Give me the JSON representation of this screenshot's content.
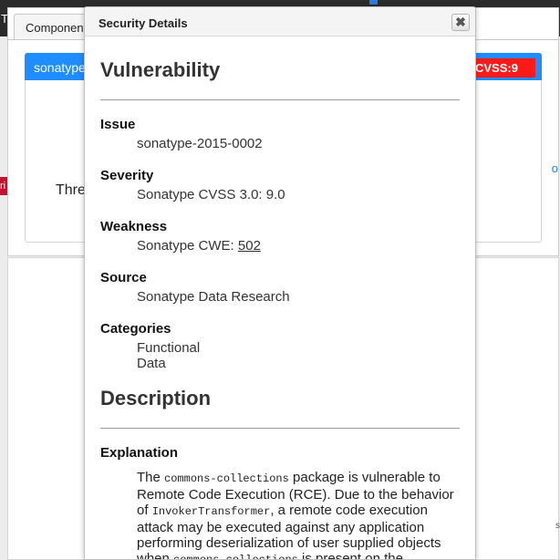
{
  "background": {
    "topbar_left_fragment": "T",
    "topbar_right_fragment": "r",
    "tab_label": "Component",
    "package_fragment": "sonatype",
    "cvss_badge": "CVSS:9",
    "threat_fragment": "Thre",
    "right_fragment": "o",
    "right_lower_fragment": "s",
    "red_tab_fragment": "ri"
  },
  "modal": {
    "title": "Security Details",
    "close_glyph": "✖",
    "vulnerability_heading": "Vulnerability",
    "issue": {
      "label": "Issue",
      "value": "sonatype-2015-0002"
    },
    "severity": {
      "label": "Severity",
      "value": "Sonatype CVSS 3.0: 9.0"
    },
    "weakness": {
      "label": "Weakness",
      "prefix": "Sonatype CWE: ",
      "link": "502"
    },
    "source": {
      "label": "Source",
      "value": "Sonatype Data Research"
    },
    "categories": {
      "label": "Categories",
      "items": [
        "Functional",
        "Data"
      ]
    },
    "description_heading": "Description",
    "explanation": {
      "label": "Explanation",
      "t1": "The ",
      "c1": "commons-collections",
      "t2": " package is vulnerable to Remote Code Execution (RCE). Due to the behavior of ",
      "c2": "InvokerTransformer",
      "t3": ", a remote code execution attack may be executed against any application performing deserialization of user supplied objects when ",
      "c3": "commons-collections",
      "t4": " is present on the"
    }
  },
  "colors": {
    "header_blue": "#1f8cff",
    "cvss_red": "#ff1a1a",
    "topbar": "#2b2b2b"
  }
}
